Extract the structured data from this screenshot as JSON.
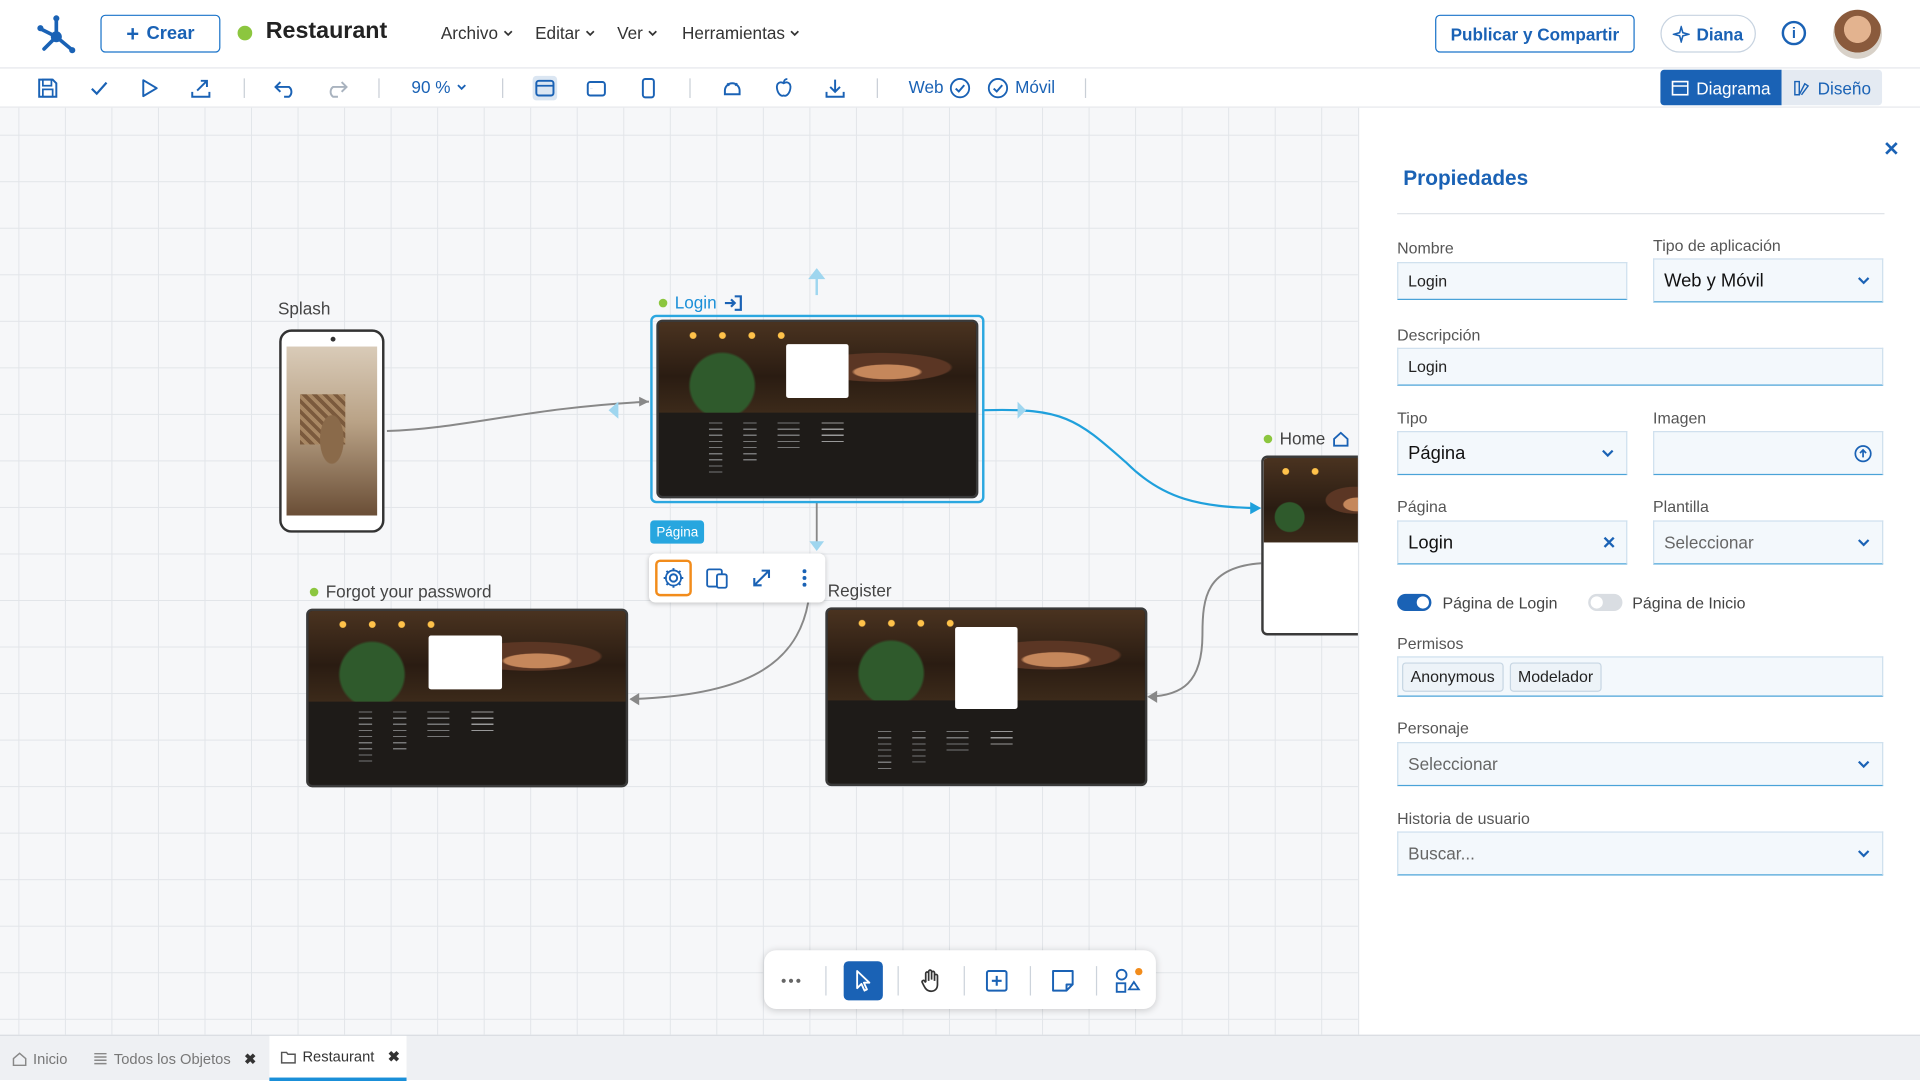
{
  "header": {
    "create_label": "Crear",
    "app_name": "Restaurant",
    "menus": [
      "Archivo",
      "Editar",
      "Ver",
      "Herramientas"
    ],
    "publish_label": "Publicar y Compartir",
    "assistant_label": "Diana",
    "logo_icon": "velneo-logo-icon"
  },
  "toolbar": {
    "zoom": "90 %",
    "web_label": "Web",
    "mobile_label": "Móvil",
    "view_diagram": "Diagrama",
    "view_design": "Diseño"
  },
  "canvas": {
    "nodes": {
      "splash": "Splash",
      "login": "Login",
      "home": "Home",
      "forgot": "Forgot your password",
      "register": "Register"
    },
    "page_tag": "Página",
    "node_actions": [
      "settings-icon",
      "responsive-icon",
      "expand-icon",
      "more-icon"
    ],
    "bottom_tools": [
      "more-dots-icon",
      "pointer-icon",
      "hand-icon",
      "add-box-icon",
      "note-icon",
      "ai-shapes-icon"
    ]
  },
  "properties": {
    "title": "Propiedades",
    "nombre_label": "Nombre",
    "nombre_value": "Login",
    "tipo_app_label": "Tipo de aplicación",
    "tipo_app_value": "Web y Móvil",
    "descripcion_label": "Descripción",
    "descripcion_value": "Login",
    "tipo_label": "Tipo",
    "tipo_value": "Página",
    "imagen_label": "Imagen",
    "pagina_label": "Página",
    "pagina_value": "Login",
    "plantilla_label": "Plantilla",
    "plantilla_placeholder": "Seleccionar",
    "login_toggle_label": "Página de Login",
    "login_toggle_on": true,
    "inicio_toggle_label": "Página de Inicio",
    "inicio_toggle_on": false,
    "permisos_label": "Permisos",
    "permisos": [
      "Anonymous",
      "Modelador"
    ],
    "personaje_label": "Personaje",
    "personaje_placeholder": "Seleccionar",
    "historia_label": "Historia de usuario",
    "historia_placeholder": "Buscar..."
  },
  "status_tabs": {
    "home": "Inicio",
    "all_objects": "Todos los Objetos",
    "restaurant": "Restaurant"
  },
  "colors": {
    "accent": "#1a62b5",
    "selection": "#2ba7e0",
    "status_green": "#8cc63f"
  }
}
